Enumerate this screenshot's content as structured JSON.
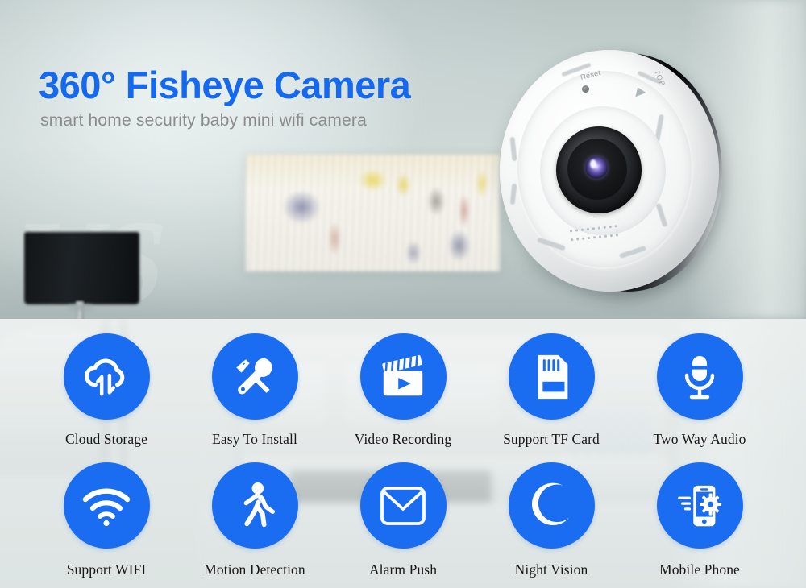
{
  "hero": {
    "headline": "360° Fisheye Camera",
    "subheadline": "smart home security baby mini wifi camera",
    "headline_color": "#1569f0",
    "subheadline_color": "#8c8c8c",
    "watermark": "VS"
  },
  "product": {
    "name": "fisheye-camera",
    "reset_label": "Reset",
    "top_label": "TOP"
  },
  "features": {
    "accent_color": "#1a6df0",
    "caption_color": "#171717",
    "items": [
      {
        "label": "Cloud Storage",
        "icon": "cloud-sync-icon"
      },
      {
        "label": "Easy To Install",
        "icon": "screwdriver-wrench-icon"
      },
      {
        "label": "Video Recording",
        "icon": "clapperboard-play-icon"
      },
      {
        "label": "Support TF Card",
        "icon": "sd-card-icon"
      },
      {
        "label": "Two Way Audio",
        "icon": "microphone-icon"
      },
      {
        "label": "Support WIFI",
        "icon": "wifi-icon"
      },
      {
        "label": "Motion Detection",
        "icon": "walking-person-icon"
      },
      {
        "label": "Alarm Push",
        "icon": "envelope-icon"
      },
      {
        "label": "Night Vision",
        "icon": "crescent-moon-icon"
      },
      {
        "label": "Mobile Phone",
        "icon": "phone-gear-icon"
      }
    ]
  }
}
